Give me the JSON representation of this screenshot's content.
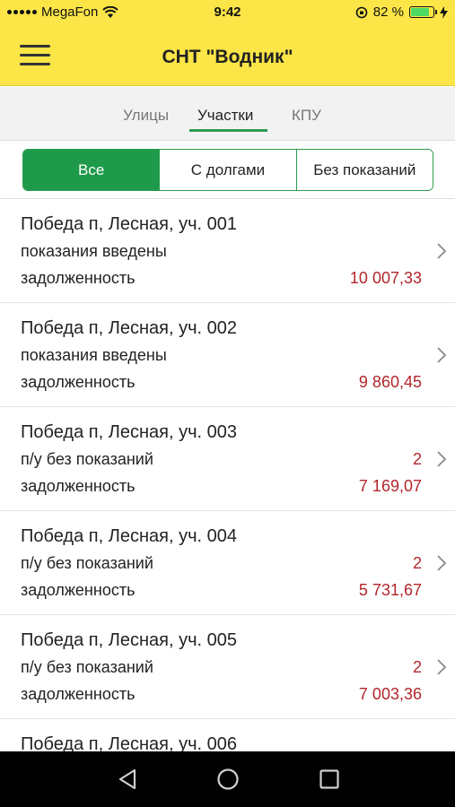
{
  "status_bar": {
    "carrier": "MegaFon",
    "time": "9:42",
    "battery_pct": "82 %",
    "battery_level": 0.82
  },
  "app": {
    "title": "СНТ \"Водник\""
  },
  "tabs": [
    {
      "label": "Улицы",
      "active": false
    },
    {
      "label": "Участки",
      "active": true
    },
    {
      "label": "КПУ",
      "active": false
    }
  ],
  "filters": [
    {
      "label": "Все",
      "active": true
    },
    {
      "label": "С долгами",
      "active": false
    },
    {
      "label": "Без показаний",
      "active": false
    }
  ],
  "plots": [
    {
      "title": "Победа п, Лесная, уч. 001",
      "status": "показания введены",
      "count": "",
      "debt_label": "задолженность",
      "debt": "10 007,33"
    },
    {
      "title": "Победа п, Лесная, уч. 002",
      "status": "показания введены",
      "count": "",
      "debt_label": "задолженность",
      "debt": "9 860,45"
    },
    {
      "title": "Победа п, Лесная, уч. 003",
      "status": "п/у без показаний",
      "count": "2",
      "debt_label": "задолженность",
      "debt": "7 169,07"
    },
    {
      "title": "Победа п, Лесная, уч. 004",
      "status": "п/у без показаний",
      "count": "2",
      "debt_label": "задолженность",
      "debt": "5 731,67"
    },
    {
      "title": "Победа п, Лесная, уч. 005",
      "status": "п/у без показаний",
      "count": "2",
      "debt_label": "задолженность",
      "debt": "7 003,36"
    },
    {
      "title": "Победа п, Лесная, уч. 006",
      "status": "",
      "count": "",
      "debt_label": "",
      "debt": ""
    }
  ],
  "colors": {
    "accent": "#1e9a4a",
    "header": "#fce547",
    "debt": "#b3262b"
  },
  "icons": {
    "menu": "hamburger-icon",
    "chevron": "chevron-right-icon",
    "back": "back-triangle-icon",
    "home": "home-circle-icon",
    "recents": "recents-square-icon"
  }
}
